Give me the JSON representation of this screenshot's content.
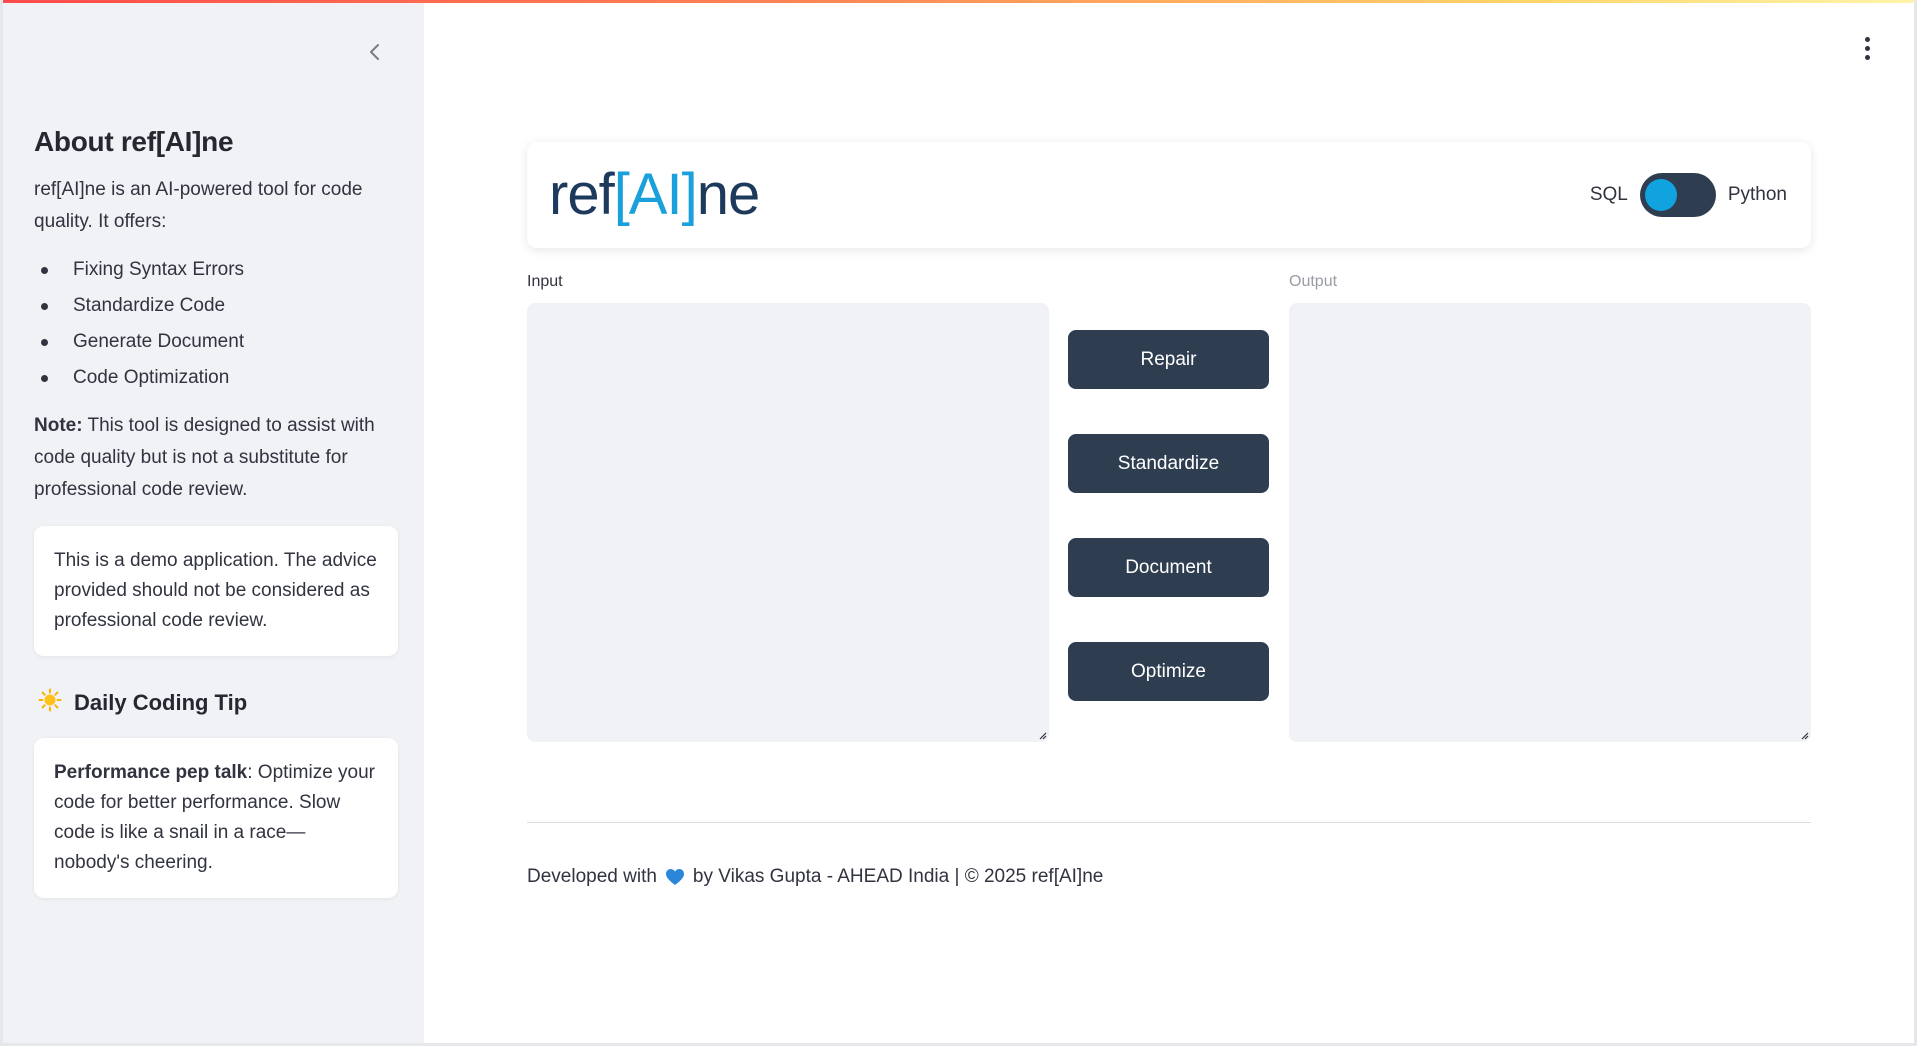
{
  "sidebar": {
    "title": "About ref[AI]ne",
    "intro": "ref[AI]ne is an AI-powered tool for code quality. It offers:",
    "features": [
      "Fixing Syntax Errors",
      "Standardize Code",
      "Generate Document",
      "Code Optimization"
    ],
    "note_label": "Note:",
    "note_text": " This tool is designed to assist with code quality but is not a substitute for professional code review.",
    "disclaimer": "This is a demo application. The advice provided should not be considered as professional code review.",
    "tip_heading": "Daily Coding Tip",
    "tip_icon": "sun-icon",
    "tip_label": "Performance pep talk",
    "tip_text": ": Optimize your code for better performance. Slow code is like a snail in a race—nobody's cheering."
  },
  "header": {
    "logo_prefix": "ref",
    "logo_accent": "[AI]",
    "logo_suffix": "ne",
    "toggle_left": "SQL",
    "toggle_right": "Python",
    "toggle_state": "SQL"
  },
  "editor": {
    "input_label": "Input",
    "output_label": "Output",
    "input_value": "",
    "output_value": ""
  },
  "actions": {
    "repair": "Repair",
    "standardize": "Standardize",
    "document": "Document",
    "optimize": "Optimize"
  },
  "footer": {
    "prefix": "Developed with",
    "suffix": "by Vikas Gupta - AHEAD India | © 2025 ref[AI]ne",
    "heart_icon": "blue-heart-icon"
  },
  "colors": {
    "primary_button": "#2e3e50",
    "accent_blue": "#1aa0db",
    "logo_dark": "#1d3a5c",
    "sidebar_bg": "#f0f2f6"
  }
}
